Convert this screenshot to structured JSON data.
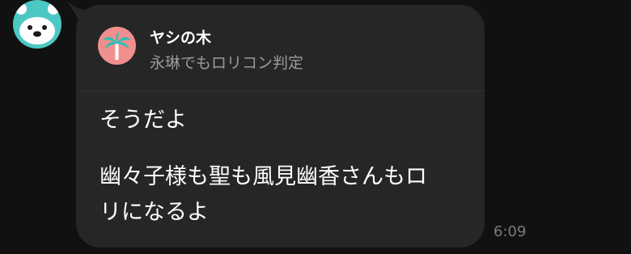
{
  "sender": {
    "avatar_icon": "bear-face-icon",
    "avatar_color": "#4cc8c4"
  },
  "reply": {
    "name": "ヤシの木",
    "preview": "永琳でもロリコン判定",
    "avatar_icon": "palm-tree-icon",
    "avatar_color": "#f08f8d"
  },
  "message": {
    "lines": [
      "そうだよ",
      "幽々子様も聖も風見幽香さんもロ",
      "リになるよ"
    ],
    "time": "6:09"
  },
  "colors": {
    "background": "#111111",
    "bubble": "#262626",
    "text": "#ffffff",
    "muted": "#9a9a9a"
  }
}
